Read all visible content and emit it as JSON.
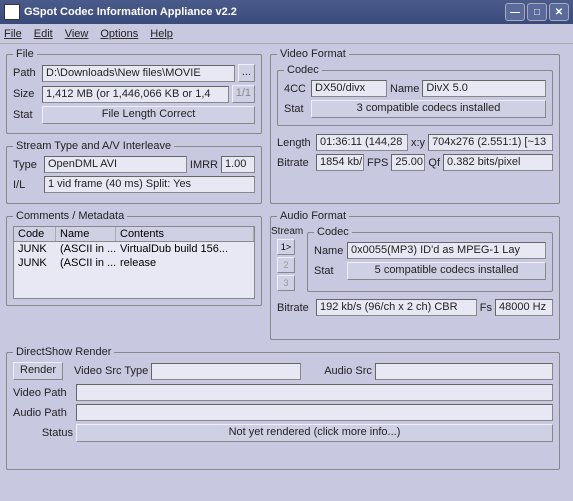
{
  "window": {
    "title": "GSpot Codec Information Appliance  v2.2"
  },
  "menu": {
    "file": "File",
    "edit": "Edit",
    "view": "View",
    "options": "Options",
    "help": "Help"
  },
  "file": {
    "legend": "File",
    "path_label": "Path",
    "path": "D:\\Downloads\\New files\\MOVIE",
    "browse": "...",
    "size_label": "Size",
    "size": "1,412 MB (or 1,446,066 KB or 1,4",
    "frac": "1/1",
    "stat_label": "Stat",
    "stat": "File Length Correct"
  },
  "stream": {
    "legend": "Stream Type and A/V Interleave",
    "type_label": "Type",
    "type": "OpenDML AVI",
    "imrr_label": "IMRR",
    "imrr": "1.00",
    "il_label": "I/L",
    "il": "1 vid frame (40 ms)  Split: Yes"
  },
  "comments": {
    "legend": "Comments / Metadata",
    "cols": {
      "code": "Code",
      "name": "Name",
      "contents": "Contents"
    },
    "rows": [
      {
        "code": "JUNK",
        "name": "(ASCII in ...",
        "contents": "VirtualDub build 156..."
      },
      {
        "code": "JUNK",
        "name": "(ASCII in ...",
        "contents": "release"
      }
    ]
  },
  "video": {
    "legend": "Video Format",
    "codec_legend": "Codec",
    "fourcc_label": "4CC",
    "fourcc": "DX50/divx",
    "name_label": "Name",
    "name": "DivX 5.0",
    "stat_label": "Stat",
    "stat": "3 compatible codecs installed",
    "length_label": "Length",
    "length": "01:36:11 (144,28",
    "xy_label": "x:y",
    "xy": "704x276 (2.551:1) [~13",
    "bitrate_label": "Bitrate",
    "bitrate": "1854 kb/",
    "fps_label": "FPS",
    "fps": "25.00",
    "qf_label": "Qf",
    "qf": "0.382 bits/pixel"
  },
  "audio": {
    "legend": "Audio Format",
    "stream_label": "Stream",
    "codec_legend": "Codec",
    "stream_btns": [
      "1>",
      "2",
      "3"
    ],
    "name_label": "Name",
    "name": "0x0055(MP3) ID'd as MPEG-1 Lay",
    "stat_label": "Stat",
    "stat": "5 compatible codecs installed",
    "bitrate_label": "Bitrate",
    "bitrate": "192 kb/s (96/ch x 2 ch) CBR",
    "fs_label": "Fs",
    "fs": "48000 Hz"
  },
  "render": {
    "legend": "DirectShow Render",
    "render_btn": "Render",
    "vst_label": "Video Src Type",
    "vst": "",
    "asrc_label": "Audio Src",
    "asrc": "",
    "vpath_label": "Video Path",
    "vpath": "",
    "apath_label": "Audio Path",
    "apath": "",
    "status_label": "Status",
    "status": "Not yet rendered (click more info...)"
  }
}
